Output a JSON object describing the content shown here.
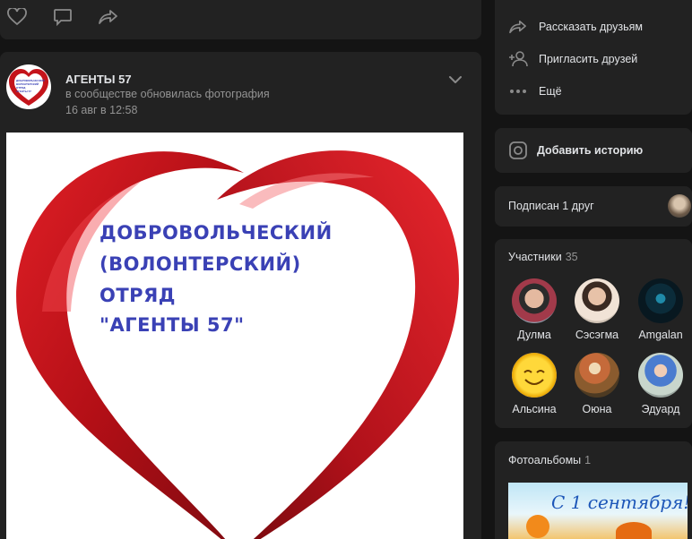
{
  "post": {
    "author": "АГЕНТЫ 57",
    "action": "в сообществе обновилась фотография",
    "date": "16 авг в 12:58",
    "image_text": [
      "ДОБРОВОЛЬЧЕСКИЙ",
      "(ВОЛОНТЕРСКИЙ)",
      "ОТРЯД",
      "\"АГЕНТЫ 57\""
    ],
    "avatar_text": [
      "ДОБРОВОЛЬЧЕСКИЙ",
      "ВОЛОНТЕРСКИЙ",
      "ОТРЯД",
      "АГЕНТЫ 57"
    ]
  },
  "actions_menu": [
    {
      "label": "Рассказать друзьям",
      "icon": "share-icon"
    },
    {
      "label": "Пригласить друзей",
      "icon": "add-person-icon"
    },
    {
      "label": "Ещё",
      "icon": "more-dots-icon"
    }
  ],
  "story": {
    "label": "Добавить историю",
    "icon": "instagram-icon"
  },
  "subscribed": {
    "label": "Подписан 1 друг"
  },
  "members": {
    "title": "Участники",
    "count": "35",
    "list": [
      {
        "name": "Дулма"
      },
      {
        "name": "Сэсэгма"
      },
      {
        "name": "Amgalan"
      },
      {
        "name": "Альсина"
      },
      {
        "name": "Оюна"
      },
      {
        "name": "Эдуард"
      }
    ]
  },
  "albums": {
    "title": "Фотоальбомы",
    "count": "1",
    "cover_text": "С 1 сентября!"
  },
  "colors": {
    "accent_red": "#c4141b",
    "text_blue": "#3a41b5",
    "card_bg": "#222222",
    "page_bg": "#141414"
  }
}
